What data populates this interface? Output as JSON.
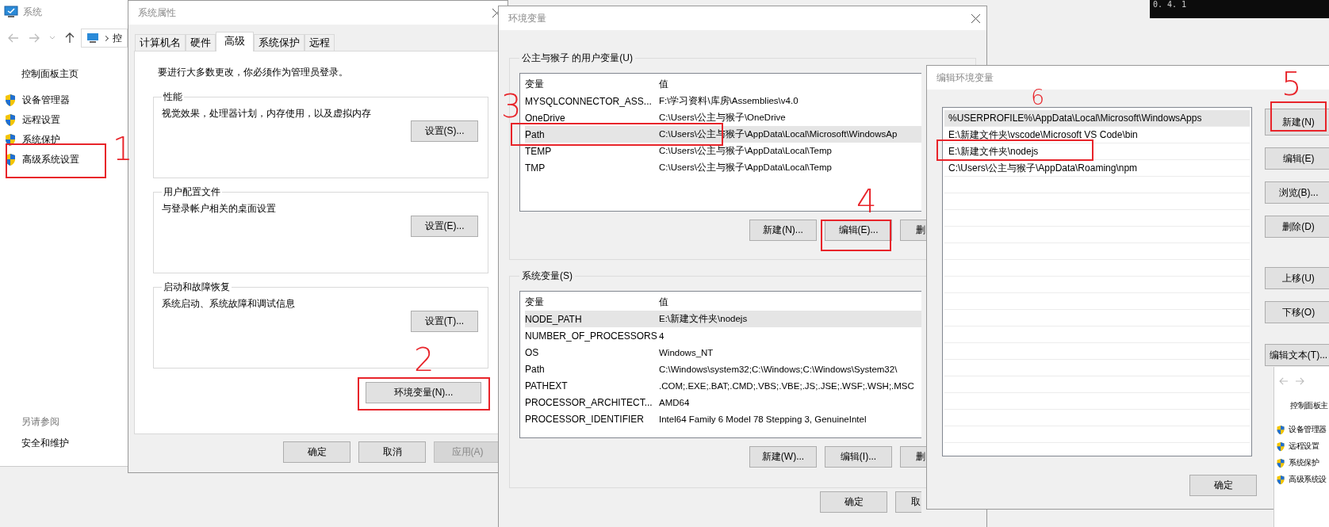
{
  "system_window": {
    "title": "系统",
    "breadcrumb": "控",
    "home_link": "控制面板主页",
    "tasks": [
      {
        "label": "设备管理器"
      },
      {
        "label": "远程设置"
      },
      {
        "label": "系统保护"
      },
      {
        "label": "高级系统设置"
      }
    ],
    "see_also": {
      "heading": "另请参阅",
      "links": [
        "安全和维护"
      ]
    }
  },
  "system_properties": {
    "title": "系统属性",
    "tabs": [
      {
        "label": "计算机名",
        "selected": false
      },
      {
        "label": "硬件",
        "selected": false
      },
      {
        "label": "高级",
        "selected": true
      },
      {
        "label": "系统保护",
        "selected": false
      },
      {
        "label": "远程",
        "selected": false
      }
    ],
    "notice": "要进行大多数更改，你必须作为管理员登录。",
    "groups": [
      {
        "title": "性能",
        "description": "视觉效果，处理器计划，内存使用，以及虚拟内存",
        "button": "设置(S)..."
      },
      {
        "title": "用户配置文件",
        "description": "与登录帐户相关的桌面设置",
        "button": "设置(E)..."
      },
      {
        "title": "启动和故障恢复",
        "description": "系统启动、系统故障和调试信息",
        "button": "设置(T)..."
      }
    ],
    "env_button": "环境变量(N)...",
    "footer_buttons": [
      {
        "label": "确定",
        "disabled": false
      },
      {
        "label": "取消",
        "disabled": false
      },
      {
        "label": "应用(A)",
        "disabled": true
      }
    ]
  },
  "environment_variables": {
    "title": "环境变量",
    "sections": [
      {
        "title": "公主与猴子 的用户变量(U)",
        "columns": [
          "变量",
          "值"
        ],
        "rows": [
          {
            "name": "MYSQLCONNECTOR_ASS...",
            "value": "F:\\学习资料\\库房\\Assemblies\\v4.0",
            "selected": false
          },
          {
            "name": "OneDrive",
            "value": "C:\\Users\\公主与猴子\\OneDrive",
            "selected": false
          },
          {
            "name": "Path",
            "value": "C:\\Users\\公主与猴子\\AppData\\Local\\Microsoft\\WindowsAp",
            "selected": true
          },
          {
            "name": "TEMP",
            "value": "C:\\Users\\公主与猴子\\AppData\\Local\\Temp",
            "selected": false
          },
          {
            "name": "TMP",
            "value": "C:\\Users\\公主与猴子\\AppData\\Local\\Temp",
            "selected": false
          }
        ],
        "buttons": [
          "新建(N)...",
          "编辑(E)...",
          "删"
        ]
      },
      {
        "title": "系统变量(S)",
        "columns": [
          "变量",
          "值"
        ],
        "rows": [
          {
            "name": "NODE_PATH",
            "value": "E:\\新建文件夹\\nodejs",
            "selected": true
          },
          {
            "name": "NUMBER_OF_PROCESSORS",
            "value": "4",
            "selected": false
          },
          {
            "name": "OS",
            "value": "Windows_NT",
            "selected": false
          },
          {
            "name": "Path",
            "value": "C:\\Windows\\system32;C:\\Windows;C:\\Windows\\System32\\",
            "selected": false
          },
          {
            "name": "PATHEXT",
            "value": ".COM;.EXE;.BAT;.CMD;.VBS;.VBE;.JS;.JSE;.WSF;.WSH;.MSC",
            "selected": false
          },
          {
            "name": "PROCESSOR_ARCHITECT...",
            "value": "AMD64",
            "selected": false
          },
          {
            "name": "PROCESSOR_IDENTIFIER",
            "value": "Intel64 Family 6 Model 78 Stepping 3, GenuineIntel",
            "selected": false
          }
        ],
        "buttons": [
          "新建(W)...",
          "编辑(I)...",
          "删"
        ]
      }
    ],
    "footer_buttons": [
      "确定",
      "取"
    ]
  },
  "edit_dialog": {
    "title": "编辑环境变量",
    "entries": [
      {
        "text": "%USERPROFILE%\\AppData\\Local\\Microsoft\\WindowsApps",
        "selected": true
      },
      {
        "text": "E:\\新建文件夹\\vscode\\Microsoft VS Code\\bin",
        "selected": false
      },
      {
        "text": "E:\\新建文件夹\\nodejs",
        "selected": false
      },
      {
        "text": "C:\\Users\\公主与猴子\\AppData\\Roaming\\npm",
        "selected": false
      }
    ],
    "buttons": [
      "新建(N)",
      "编辑(E)",
      "浏览(B)...",
      "删除(D)",
      "上移(U)",
      "下移(O)",
      "编辑文本(T)..."
    ],
    "footer_buttons": [
      "确定"
    ]
  },
  "inset_screenshot": {
    "home_link": "控制面板主",
    "tasks": [
      "设备管理器",
      "远程设置",
      "系统保护",
      "高级系统设"
    ]
  },
  "terminal": {
    "text": "0. 4. 1"
  },
  "annotations": [
    {
      "label": "1"
    },
    {
      "label": "2"
    },
    {
      "label": "3"
    },
    {
      "label": "4"
    },
    {
      "label": "5"
    },
    {
      "label": "6"
    }
  ]
}
